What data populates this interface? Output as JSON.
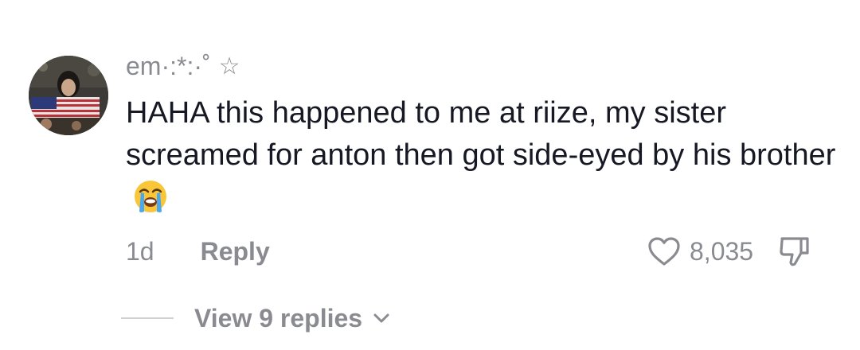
{
  "comment": {
    "username": "em·:*:·˚",
    "badge_icon": "star-outline-icon",
    "text": "HAHA this happened to me at riize, my sister screamed for anton then got side-eyed by his brother",
    "emoji": "😭",
    "emoji_icon": "loudly-crying-face-icon",
    "timestamp": "1d",
    "reply_label": "Reply",
    "like_count": "8,035",
    "like_icon": "heart-outline-icon",
    "dislike_icon": "thumbs-down-outline-icon",
    "view_replies_label": "View 9 replies",
    "view_replies_icon": "chevron-down-icon"
  },
  "colors": {
    "text_primary": "#161823",
    "text_secondary": "#8a8b91",
    "divider": "#d0d1d3",
    "background": "#ffffff"
  }
}
